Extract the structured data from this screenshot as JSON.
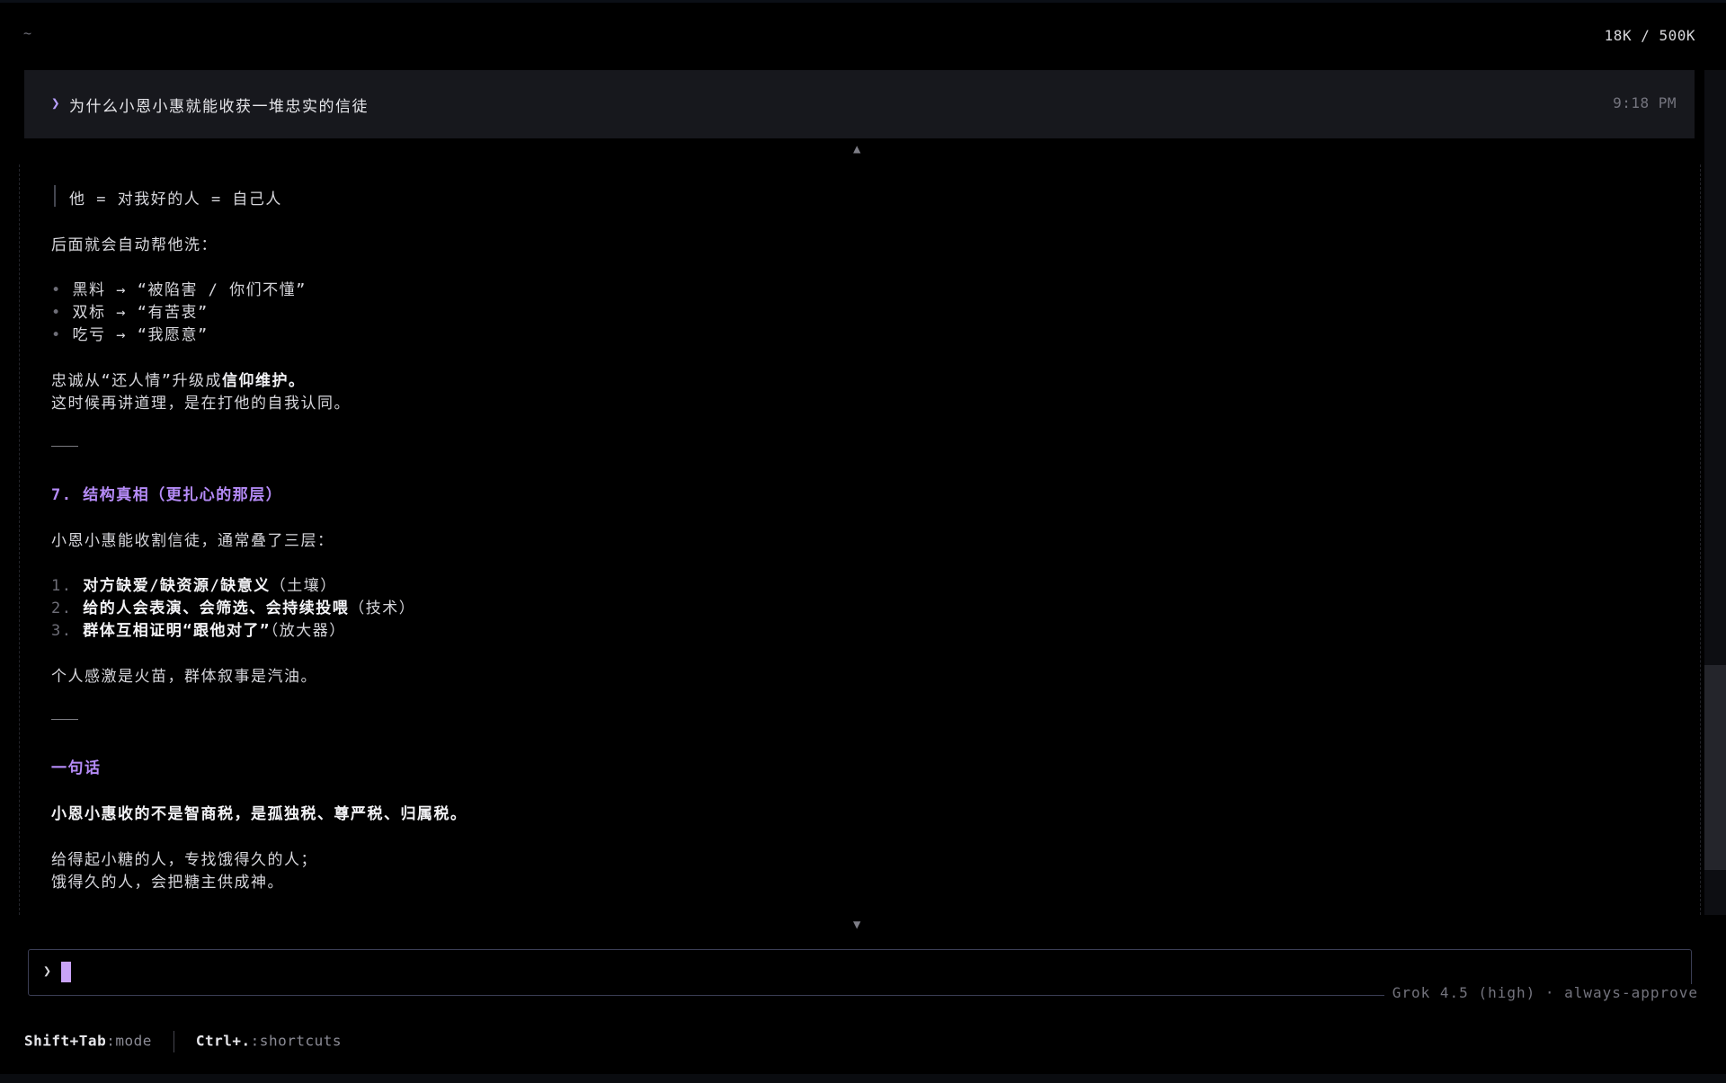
{
  "header": {
    "cwd": "~",
    "token_usage": "18K / 500K"
  },
  "prompt": {
    "chevron": "❯",
    "text": "为什么小恩小惠就能收获一堆忠实的信徒",
    "time": "9:18 PM"
  },
  "scroll": {
    "up_arrow": "▲",
    "down_arrow": "▼"
  },
  "body": {
    "quote": "他 = 对我好的人 = 自己人",
    "p1": "后面就会自动帮他洗：",
    "bullets": [
      {
        "mark": "•",
        "text": "黑料 → “被陷害 / 你们不懂”"
      },
      {
        "mark": "•",
        "text": "双标 → “有苦衷”"
      },
      {
        "mark": "•",
        "text": "吃亏 → “我愿意”"
      }
    ],
    "p2_prefix": "忠诚从“还人情”升级成",
    "p2_bold": "信仰维护。",
    "p3": "这时候再讲道理，是在打他的自我认同。",
    "section7_title": "7. 结构真相（更扎心的那层）",
    "p4": "小恩小惠能收割信徒，通常叠了三层：",
    "numbered": [
      {
        "num": "1.",
        "bold": "对方缺爱/缺资源/缺意义",
        "rest": "（土壤）"
      },
      {
        "num": "2.",
        "bold": "给的人会表演、会筛选、会持续投喂",
        "rest": "（技术）"
      },
      {
        "num": "3.",
        "bold": "群体互相证明“跟他对了”",
        "rest": "（放大器）"
      }
    ],
    "p5": "个人感激是火苗，群体叙事是汽油。",
    "summary_title": "一句话",
    "summary_bold": "小恩小惠收的不是智商税，是孤独税、尊严税、归属税。",
    "p6": "给得起小糖的人，专找饿得久的人；",
    "p7": "饿得久的人，会把糖主供成神。"
  },
  "input": {
    "chevron": "❯",
    "value": ""
  },
  "status": {
    "model": "Grok 4.5 (high) · always-approve"
  },
  "footer": {
    "shortcut1_key": "Shift+Tab",
    "shortcut1_desc": ":mode",
    "shortcut2_key": "Ctrl+.",
    "shortcut2_desc": ":shortcuts"
  },
  "colors": {
    "accent": "#b58bf7",
    "caret": "#c9a3f8",
    "background": "#000000"
  }
}
